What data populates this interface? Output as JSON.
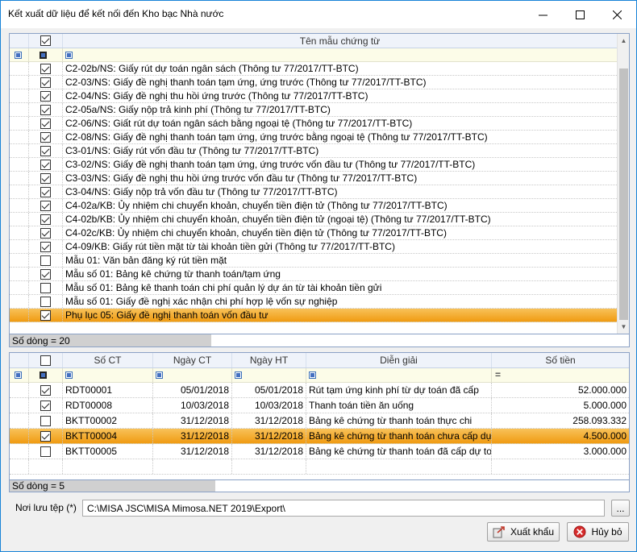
{
  "window": {
    "title": "Kết xuất dữ liệu để kết nối đến Kho bạc Nhà nước"
  },
  "templates_grid": {
    "column_header": "Tên mẫu chứng từ",
    "rows": [
      {
        "checked": true,
        "name": "C2-02b/NS: Giấy rút dự toán ngân sách (Thông tư 77/2017/TT-BTC)"
      },
      {
        "checked": true,
        "name": "C2-03/NS: Giấy đề nghị thanh toán tạm ứng, ứng trước (Thông tư 77/2017/TT-BTC)"
      },
      {
        "checked": true,
        "name": "C2-04/NS: Giấy đề nghị thu hồi ứng trước (Thông tư 77/2017/TT-BTC)"
      },
      {
        "checked": true,
        "name": "C2-05a/NS: Giấy nộp trả kinh phí (Thông tư 77/2017/TT-BTC)"
      },
      {
        "checked": true,
        "name": "C2-06/NS: Giất rút dự toán ngân sách bằng ngoại tệ (Thông tư 77/2017/TT-BTC)"
      },
      {
        "checked": true,
        "name": "C2-08/NS: Giấy đề nghị thanh toán tạm ứng, ứng trước bằng ngoại tệ (Thông tư 77/2017/TT-BTC)"
      },
      {
        "checked": true,
        "name": "C3-01/NS: Giấy rút vốn đầu tư (Thông tư 77/2017/TT-BTC)"
      },
      {
        "checked": true,
        "name": "C3-02/NS: Giấy đề nghị thanh toán tạm ứng, ứng trước vốn đầu tư (Thông tư 77/2017/TT-BTC)"
      },
      {
        "checked": true,
        "name": "C3-03/NS: Giấy đề nghị thu hồi ứng trước vốn đầu tư (Thông tư 77/2017/TT-BTC)"
      },
      {
        "checked": true,
        "name": "C3-04/NS: Giấy nộp trả vốn đầu tư (Thông tư 77/2017/TT-BTC)"
      },
      {
        "checked": true,
        "name": "C4-02a/KB: Ủy nhiệm chi chuyển khoản, chuyển tiền điện tử (Thông tư 77/2017/TT-BTC)"
      },
      {
        "checked": true,
        "name": "C4-02b/KB: Ủy nhiệm chi chuyển khoản, chuyển tiền điện tử (ngoại tệ) (Thông tư 77/2017/TT-BTC)"
      },
      {
        "checked": true,
        "name": "C4-02c/KB: Ủy nhiệm chi chuyển khoản, chuyển tiền điện tử (Thông tư 77/2017/TT-BTC)"
      },
      {
        "checked": true,
        "name": "C4-09/KB: Giấy rút tiền mặt từ tài khoản tiền gửi (Thông tư 77/2017/TT-BTC)"
      },
      {
        "checked": false,
        "name": "Mẫu 01: Văn bản đăng ký rút tiền mặt"
      },
      {
        "checked": true,
        "name": "Mẫu số 01: Bảng kê chứng từ thanh toán/tạm ứng"
      },
      {
        "checked": false,
        "name": "Mẫu số 01: Bảng kê thanh toán chi phí quản lý dự án từ tài khoản tiền gửi"
      },
      {
        "checked": false,
        "name": "Mẫu số 01: Giấy đề nghị xác nhận chi phí hợp lệ vốn sự nghiệp"
      },
      {
        "checked": true,
        "name": "Phụ lục 05: Giấy đề nghị thanh toán vốn đầu tư",
        "selected": true
      }
    ],
    "footer": "Số dòng = 20"
  },
  "vouchers_grid": {
    "headers": {
      "so_ct": "Số CT",
      "ngay_ct": "Ngày CT",
      "ngay_ht": "Ngày HT",
      "dien_giai": "Diễn giải",
      "so_tien": "Số tiền"
    },
    "filter_equals": "=",
    "rows": [
      {
        "checked": true,
        "so_ct": "RDT00001",
        "ngay_ct": "05/01/2018",
        "ngay_ht": "05/01/2018",
        "dien_giai": "Rút tạm ứng kinh phí từ dự toán đã cấp",
        "so_tien": "52.000.000"
      },
      {
        "checked": true,
        "so_ct": "RDT00008",
        "ngay_ct": "10/03/2018",
        "ngay_ht": "10/03/2018",
        "dien_giai": "Thanh toán tiền ăn uống",
        "so_tien": "5.000.000"
      },
      {
        "checked": false,
        "so_ct": "BKTT00002",
        "ngay_ct": "31/12/2018",
        "ngay_ht": "31/12/2018",
        "dien_giai": "Bảng kê chứng từ thanh toán thực chi",
        "so_tien": "258.093.332"
      },
      {
        "checked": true,
        "so_ct": "BKTT00004",
        "ngay_ct": "31/12/2018",
        "ngay_ht": "31/12/2018",
        "dien_giai": "Bảng kê chứng từ thanh toán chưa cấp dự to",
        "so_tien": "4.500.000",
        "selected": true
      },
      {
        "checked": false,
        "so_ct": "BKTT00005",
        "ngay_ct": "31/12/2018",
        "ngay_ht": "31/12/2018",
        "dien_giai": "Bảng kê chứng từ thanh toán đã cấp dự toán",
        "so_tien": "3.000.000"
      }
    ],
    "footer": "Số dòng = 5"
  },
  "save_path": {
    "label": "Nơi lưu tệp (*)",
    "value": "C:\\MISA JSC\\MISA Mimosa.NET 2019\\Export\\",
    "browse_label": "..."
  },
  "buttons": {
    "export_label": "Xuất khẩu",
    "cancel_label": "Hủy bỏ"
  },
  "colors": {
    "accent_border": "#1883d7",
    "selection": "#f4a92e",
    "grid_border": "#8aa1c6"
  }
}
